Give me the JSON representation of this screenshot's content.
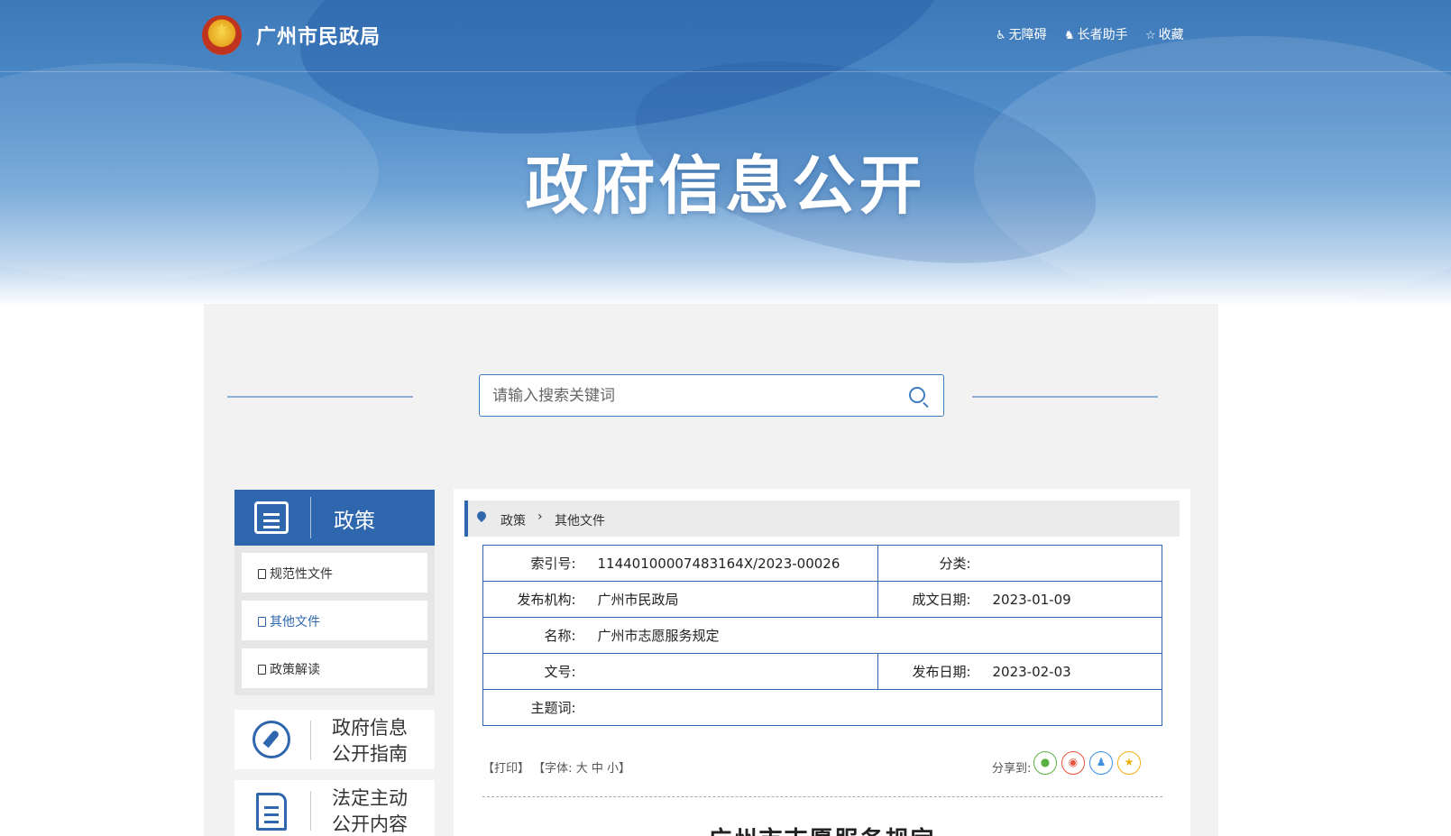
{
  "header": {
    "site_name": "广州市民政局",
    "utilities": [
      {
        "icon": "accessibility-icon",
        "label": "无障碍"
      },
      {
        "icon": "elder-helper-icon",
        "label": "长者助手"
      },
      {
        "icon": "star-outline-icon",
        "label": "收藏"
      }
    ]
  },
  "hero": {
    "title": "政府信息公开"
  },
  "search": {
    "placeholder": "请输入搜索关键词"
  },
  "sidebar": {
    "section_title": "政策",
    "items": [
      {
        "label": "规范性文件",
        "active": false
      },
      {
        "label": "其他文件",
        "active": true
      },
      {
        "label": "政策解读",
        "active": false
      }
    ],
    "cards": [
      {
        "line1": "政府信息",
        "line2": "公开指南",
        "icon": "compass-icon"
      },
      {
        "line1": "法定主动",
        "line2": "公开内容",
        "icon": "document-icon"
      }
    ]
  },
  "breadcrumb": {
    "level1": "政策",
    "level2": "其他文件"
  },
  "meta": {
    "index_label": "索引号:",
    "index_value": "11440100007483164X/2023-00026",
    "category_label": "分类:",
    "category_value": "",
    "issuer_label": "发布机构:",
    "issuer_value": "广州市民政局",
    "created_label": "成文日期:",
    "created_value": "2023-01-09",
    "name_label": "名称:",
    "name_value": "广州市志愿服务规定",
    "docno_label": "文号:",
    "docno_value": "",
    "published_label": "发布日期:",
    "published_value": "2023-02-03",
    "keywords_label": "主题词:",
    "keywords_value": ""
  },
  "tools": {
    "print": "【打印】",
    "font_prefix": "【字体:",
    "font_large": "大",
    "font_medium": "中",
    "font_small": "小】",
    "share_label": "分享到:"
  },
  "share_targets": [
    {
      "icon": "wechat-icon",
      "color": "#5bb043"
    },
    {
      "icon": "weibo-icon",
      "color": "#e6523c"
    },
    {
      "icon": "qq-icon",
      "color": "#3d8fe0"
    },
    {
      "icon": "qzone-icon",
      "color": "#f1b10f"
    }
  ],
  "document": {
    "title": "广州市志愿服务规定"
  },
  "colors": {
    "primary": "#2f67ae",
    "panel": "#f2f2f2"
  }
}
